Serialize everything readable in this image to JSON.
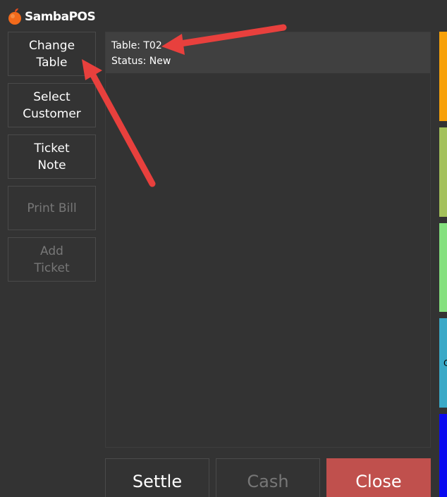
{
  "app": {
    "title": "SambaPOS",
    "logo_icon": "orange-fruit-icon"
  },
  "sidebar": {
    "buttons": [
      {
        "label": "Change\nTable",
        "enabled": true
      },
      {
        "label": "Select\nCustomer",
        "enabled": true
      },
      {
        "label": "Ticket\nNote",
        "enabled": true
      },
      {
        "label": "Print Bill",
        "enabled": false
      },
      {
        "label": "Add\nTicket",
        "enabled": false
      }
    ]
  },
  "ticket": {
    "table_line": "Table: T02",
    "status_line": "Status: New"
  },
  "actions": {
    "settle": "Settle",
    "cash": "Cash",
    "close": "Close"
  },
  "category_tiles": [
    {
      "color": "#f7a10a",
      "glyph": ""
    },
    {
      "color": "#a4c15b",
      "glyph": ""
    },
    {
      "color": "#84e07e",
      "glyph": ""
    },
    {
      "color": "#3aa9c7",
      "glyph": "Q"
    },
    {
      "color": "#0a0af0",
      "glyph": ""
    }
  ],
  "colors": {
    "background": "#333333",
    "ticket_header": "#404040",
    "close_button": "#c0504d",
    "annotation_arrow": "#e8403d"
  }
}
